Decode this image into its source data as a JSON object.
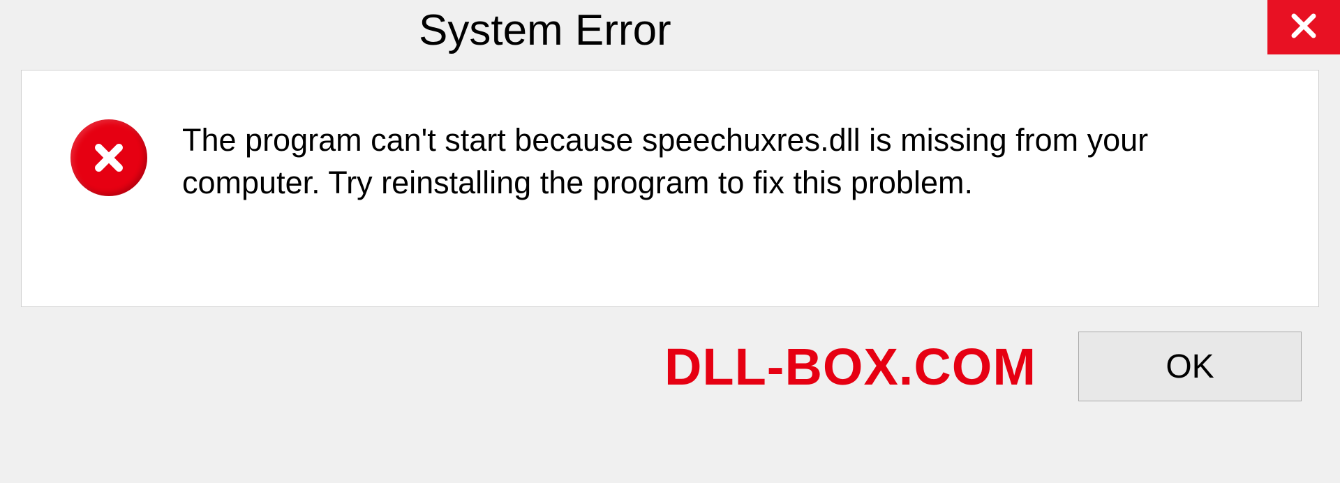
{
  "dialog": {
    "title": "System Error",
    "message": "The program can't start because speechuxres.dll is missing from your computer. Try reinstalling the program to fix this problem.",
    "ok_label": "OK"
  },
  "watermark": "DLL-BOX.COM",
  "colors": {
    "close_red": "#e81123",
    "error_red": "#e60012"
  }
}
